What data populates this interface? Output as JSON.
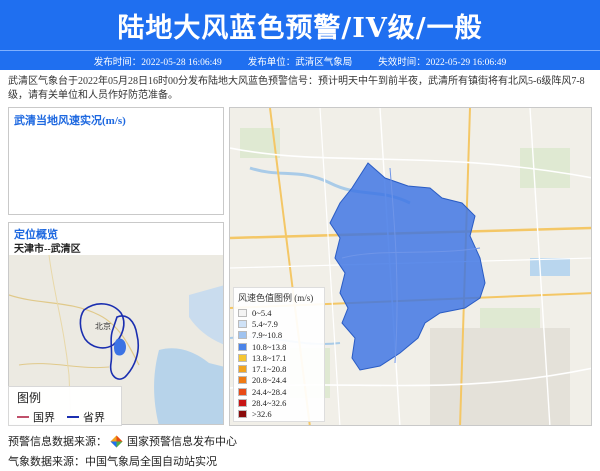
{
  "header": {
    "title": "陆地大风蓝色预警/IV级/一般",
    "issue_time": "发布时间：2022-05-28 16:06:49",
    "issuer": "发布单位：武清区气象局",
    "expire_time": "失效时间：2022-05-29 16:06:49"
  },
  "description": "武清区气象台于2022年05月28日16时00分发布陆地大风蓝色预警信号：预计明天中午到前半夜，武清所有镇街将有北风5-6级阵风7-8级，请有关单位和人员作好防范准备。",
  "wind_panel": {
    "title": "武清当地风速实况(m/s)"
  },
  "location_panel": {
    "title": "定位概览",
    "subtitle": "天津市--武清区",
    "map_labels": {
      "beijing": "北京"
    }
  },
  "boundary_legend": {
    "title": "图例",
    "items": [
      {
        "label": "国界",
        "color": "#c0506a"
      },
      {
        "label": "省界",
        "color": "#1b2fb0"
      }
    ]
  },
  "wind_legend": {
    "title": "风速色值图例 (m/s)",
    "items": [
      {
        "label": "0~5.4",
        "color": "#f4f4f4"
      },
      {
        "label": "5.4~7.9",
        "color": "#cfe2f7"
      },
      {
        "label": "7.9~10.8",
        "color": "#9fc3f0"
      },
      {
        "label": "10.8~13.8",
        "color": "#4a83e8"
      },
      {
        "label": "13.8~17.1",
        "color": "#f5c531"
      },
      {
        "label": "17.1~20.8",
        "color": "#f2a41f"
      },
      {
        "label": "20.8~24.4",
        "color": "#ef7a14"
      },
      {
        "label": "24.4~28.4",
        "color": "#e84a16"
      },
      {
        "label": "28.4~32.6",
        "color": "#c81414"
      },
      {
        "label": ">32.6",
        "color": "#8a0b0b"
      }
    ]
  },
  "footer": {
    "warning_source_label": "预警信息数据来源：",
    "warning_source": "国家预警信息发布中心",
    "weather_source_label": "气象数据来源：",
    "weather_source": "中国气象局全国自动站实况"
  },
  "colors": {
    "brand": "#1f6ff0",
    "warning_area": "#3b73e4"
  }
}
